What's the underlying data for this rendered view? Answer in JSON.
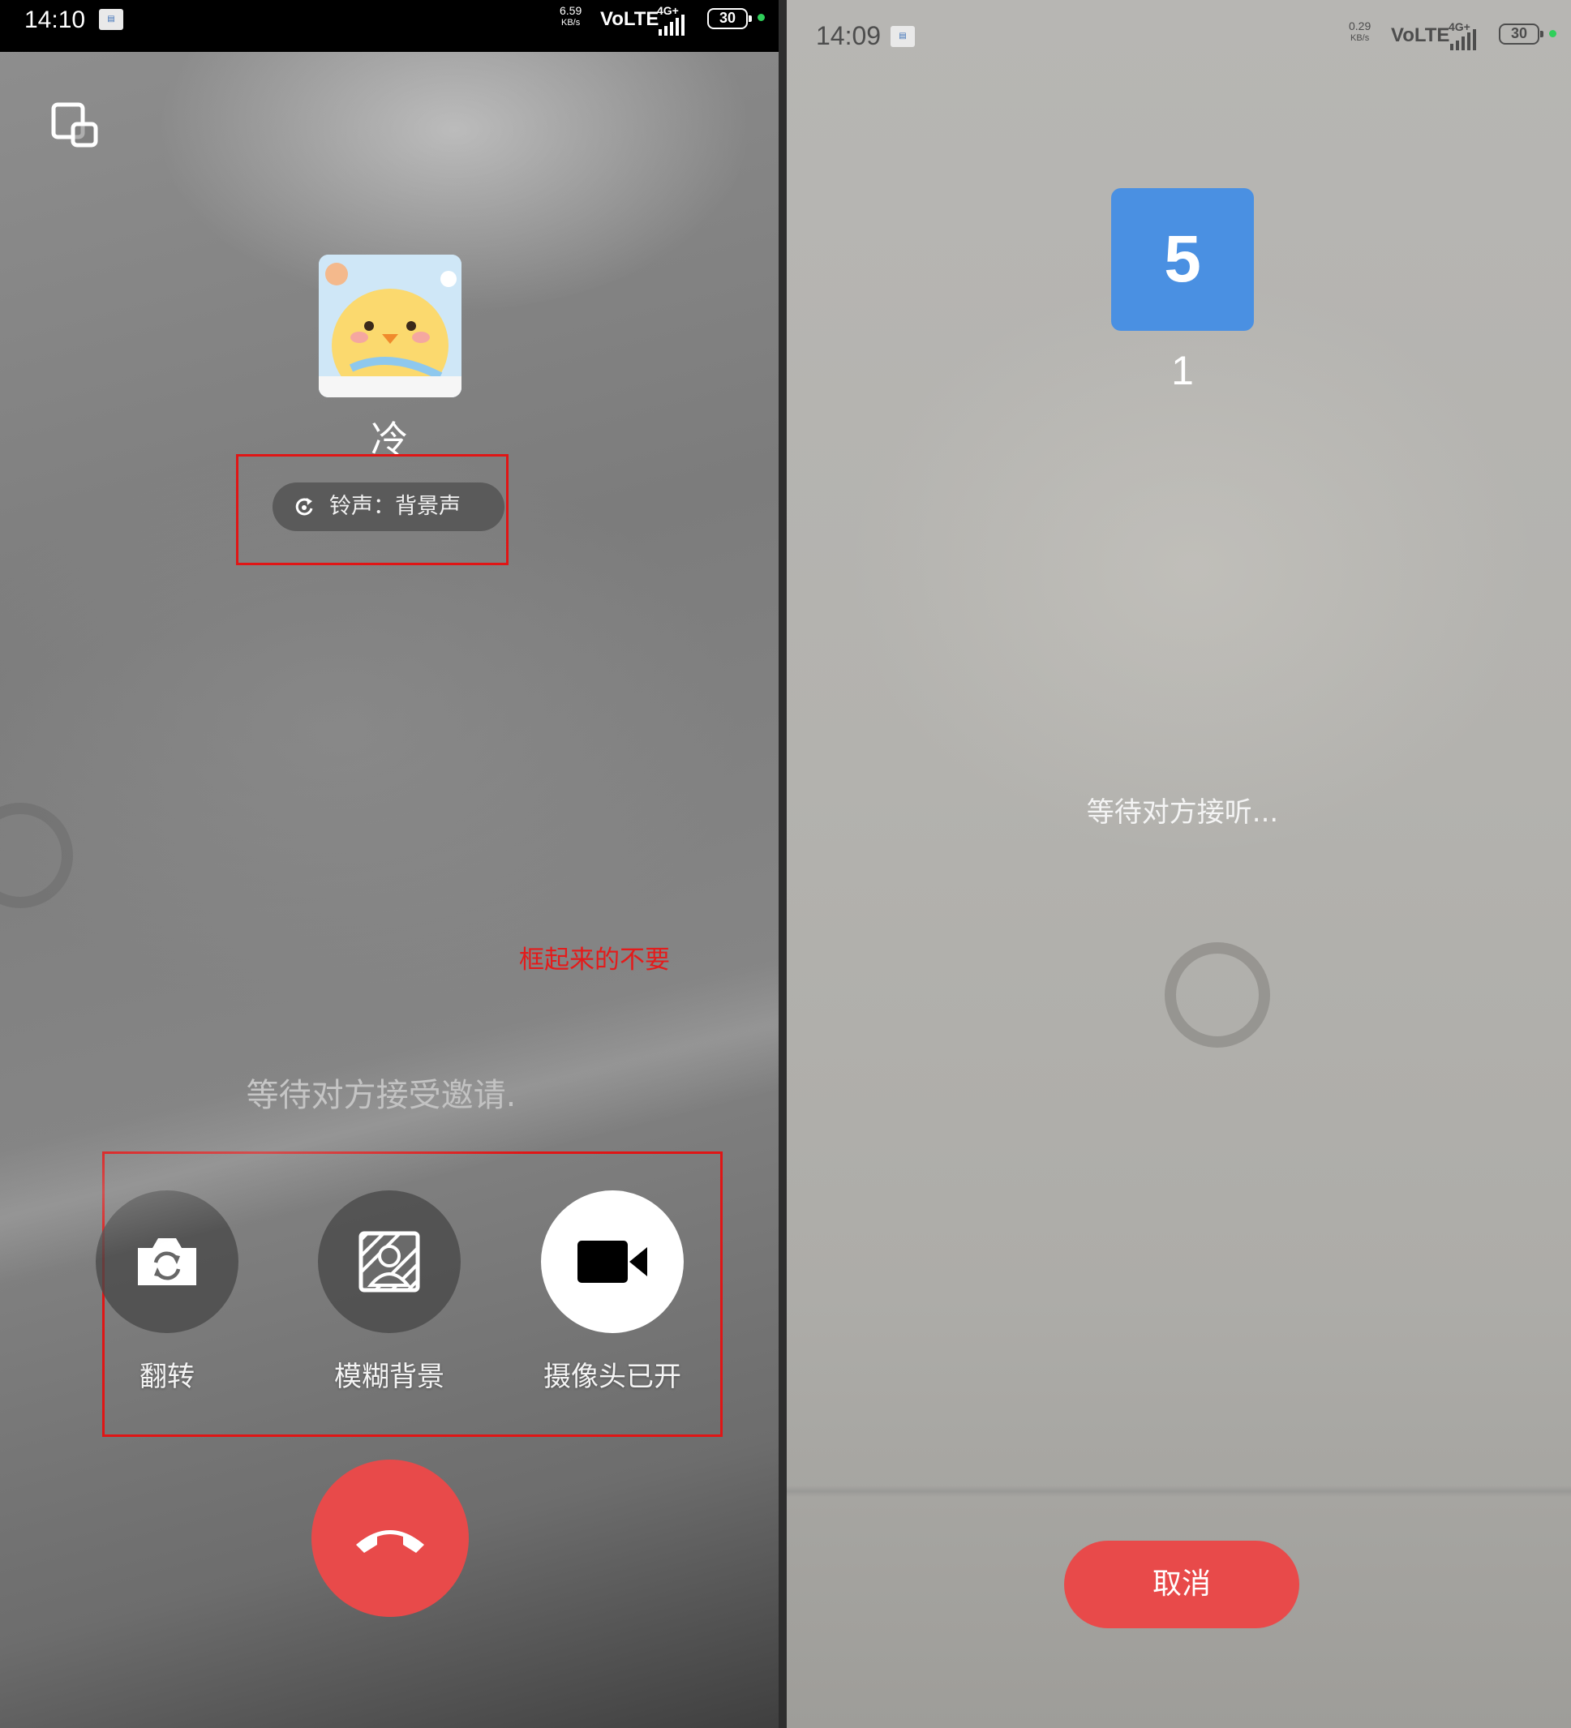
{
  "left_screen": {
    "status_bar": {
      "time": "14:10",
      "speed_value": "6.59",
      "speed_unit": "KB/s",
      "volte": "VoLTE",
      "network": "4G+",
      "battery": "30"
    },
    "caller": {
      "name": "冷"
    },
    "ringtone": {
      "label": "铃声：背景声"
    },
    "annotation": "框起来的不要",
    "waiting_text": "等待对方接受邀请.",
    "controls": [
      {
        "label": "翻转",
        "icon": "flip-camera-icon"
      },
      {
        "label": "模糊背景",
        "icon": "blur-background-icon"
      },
      {
        "label": "摄像头已开",
        "icon": "video-camera-icon"
      }
    ],
    "hangup_icon": "hang-up-icon",
    "colors": {
      "annotation": "#e01515",
      "hangup": "#e84a4a"
    }
  },
  "right_screen": {
    "status_bar": {
      "time": "14:09",
      "speed_value": "0.29",
      "speed_unit": "KB/s",
      "volte": "VoLTE",
      "network": "4G+",
      "battery": "30"
    },
    "group": {
      "avatar_text": "5",
      "name": "1"
    },
    "waiting_text": "等待对方接听...",
    "cancel_label": "取消",
    "colors": {
      "avatar": "#4a90e2",
      "cancel": "#e84a4a"
    }
  }
}
